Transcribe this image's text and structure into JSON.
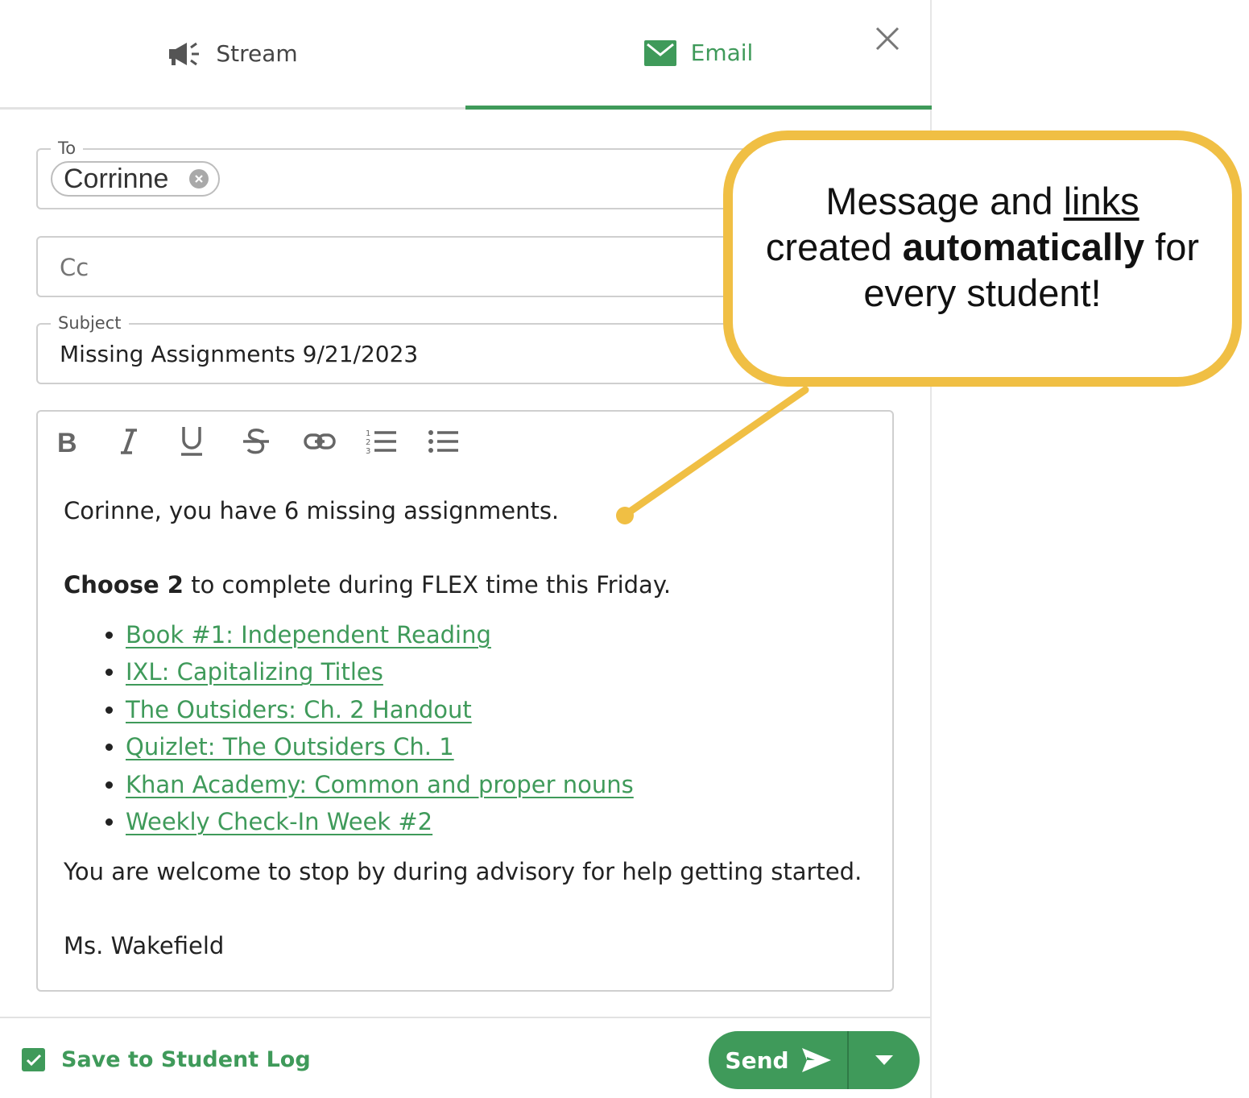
{
  "tabs": {
    "stream": {
      "label": "Stream",
      "icon": "megaphone-icon"
    },
    "email": {
      "label": "Email",
      "icon": "envelope-icon",
      "active": true
    }
  },
  "close_icon": "close-icon",
  "to": {
    "legend": "To",
    "recipients": [
      {
        "name": "Corrinne"
      }
    ]
  },
  "cc": {
    "placeholder": "Cc"
  },
  "subject": {
    "legend": "Subject",
    "value": "Missing Assignments 9/21/2023"
  },
  "toolbar": {
    "buttons": [
      "bold",
      "italic",
      "underline",
      "strikethrough",
      "link",
      "ordered-list",
      "bullet-list"
    ]
  },
  "message": {
    "line1": "Corinne, you have 6 missing assignments.",
    "choose_bold": "Choose 2",
    "choose_rest": " to complete during FLEX time this Friday.",
    "links": [
      "Book #1: Independent Reading",
      "IXL: Capitalizing Titles",
      "The Outsiders: Ch. 2 Handout",
      "Quizlet: The Outsiders Ch. 1",
      "Khan Academy: Common and proper nouns",
      "Weekly Check-In Week #2"
    ],
    "closing": "You are welcome to stop by during advisory for help getting started.",
    "signature": "Ms. Wakefield"
  },
  "footer": {
    "save_to_log_label": "Save to Student Log",
    "save_to_log_checked": true,
    "send_label": "Send"
  },
  "callout": {
    "part1": "Message and ",
    "links_word": "links",
    "part2": "created ",
    "bold_word": "automatically",
    "part3": " for",
    "part4": "every student!"
  },
  "colors": {
    "accent": "#3f9a5a",
    "callout_border": "#f0bf44"
  }
}
